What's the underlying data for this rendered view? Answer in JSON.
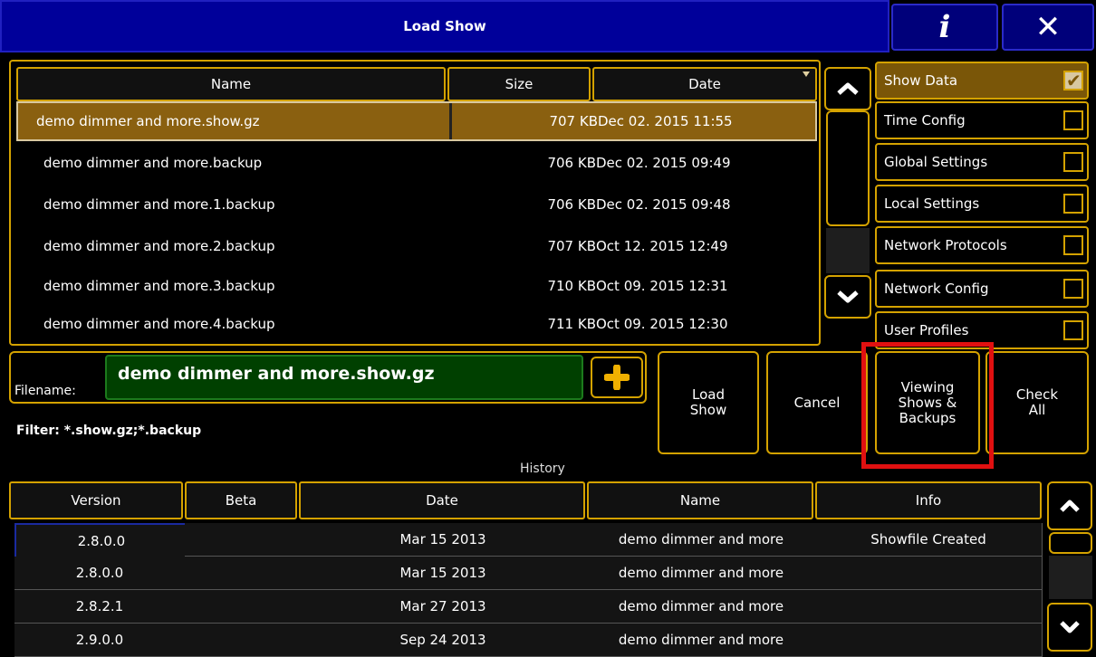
{
  "window": {
    "title": "Load Show",
    "info_label": "i",
    "close_label": "✕"
  },
  "filelist": {
    "columns": [
      "Name",
      "Size",
      "Date"
    ],
    "rows": [
      {
        "name": "demo dimmer and more.show.gz",
        "size": "707 KB",
        "date": "Dec 02. 2015 11:55",
        "selected": true
      },
      {
        "name": "demo dimmer and more.backup",
        "size": "706 KB",
        "date": "Dec 02. 2015 09:49"
      },
      {
        "name": "demo dimmer and more.1.backup",
        "size": "706 KB",
        "date": "Dec 02. 2015 09:48"
      },
      {
        "name": "demo dimmer and more.2.backup",
        "size": "707 KB",
        "date": "Oct 12. 2015 12:49"
      },
      {
        "name": "demo dimmer and more.3.backup",
        "size": "710 KB",
        "date": "Oct 09. 2015 12:31"
      },
      {
        "name": "demo dimmer and more.4.backup",
        "size": "711 KB",
        "date": "Oct 09. 2015 12:30"
      }
    ]
  },
  "options": [
    {
      "label": "Show Data",
      "checked": true
    },
    {
      "label": "Time Config",
      "checked": false
    },
    {
      "label": "Global Settings",
      "checked": false
    },
    {
      "label": "Local Settings",
      "checked": false
    },
    {
      "label": "Network Protocols",
      "checked": false
    },
    {
      "label": "Network Config",
      "checked": false
    },
    {
      "label": "User Profiles",
      "checked": false
    }
  ],
  "filename": {
    "label": "Filename:",
    "value": "demo dimmer and more.show.gz",
    "add_icon": "plus-icon"
  },
  "filter": "Filter: *.show.gz;*.backup",
  "actions": {
    "load": "Load\nShow",
    "cancel": "Cancel",
    "viewing": "Viewing\nShows &\nBackups",
    "check_all": "Check\nAll"
  },
  "history": {
    "label": "History",
    "columns": [
      "Version",
      "Beta",
      "Date",
      "Name",
      "Info"
    ],
    "rows": [
      {
        "version": "2.8.0.0",
        "beta": "",
        "date": "Mar 15 2013",
        "name": "demo dimmer and more",
        "info": "Showfile Created"
      },
      {
        "version": "2.8.0.0",
        "beta": "",
        "date": "Mar 15 2013",
        "name": "demo dimmer and more",
        "info": ""
      },
      {
        "version": "2.8.2.1",
        "beta": "",
        "date": "Mar 27 2013",
        "name": "demo dimmer and more",
        "info": ""
      },
      {
        "version": "2.9.0.0",
        "beta": "",
        "date": "Sep 24 2013",
        "name": "demo dimmer and more",
        "info": ""
      }
    ]
  },
  "colors": {
    "accent": "#d4a200",
    "title_bg": "#00009a",
    "selected_bg": "#8a6010",
    "filename_bg": "#004000",
    "highlight": "#e01010"
  }
}
